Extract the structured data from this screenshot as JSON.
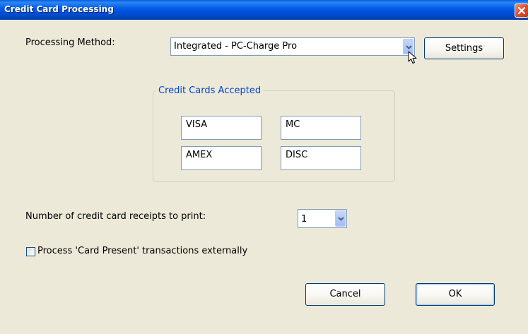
{
  "window": {
    "title": "Credit Card Processing"
  },
  "processing": {
    "label": "Processing Method:",
    "selected": "Integrated - PC-Charge Pro",
    "settings_label": "Settings"
  },
  "cards": {
    "group_title": "Credit Cards Accepted",
    "items": [
      "VISA",
      "MC",
      "AMEX",
      "DISC"
    ]
  },
  "receipts": {
    "label": "Number of credit card receipts to print:",
    "selected": "1"
  },
  "card_present": {
    "label": "Process 'Card Present' transactions externally",
    "checked": false
  },
  "buttons": {
    "cancel_label": "Cancel",
    "ok_label": "OK"
  },
  "icons": {
    "close": "close-icon",
    "dropdown": "chevron-down-icon",
    "cursor": "mouse-pointer-icon"
  },
  "colors": {
    "titlebar": "#0058e6",
    "window_bg": "#ece9d8",
    "group_title": "#0046d5",
    "close_button": "#e0552f"
  }
}
